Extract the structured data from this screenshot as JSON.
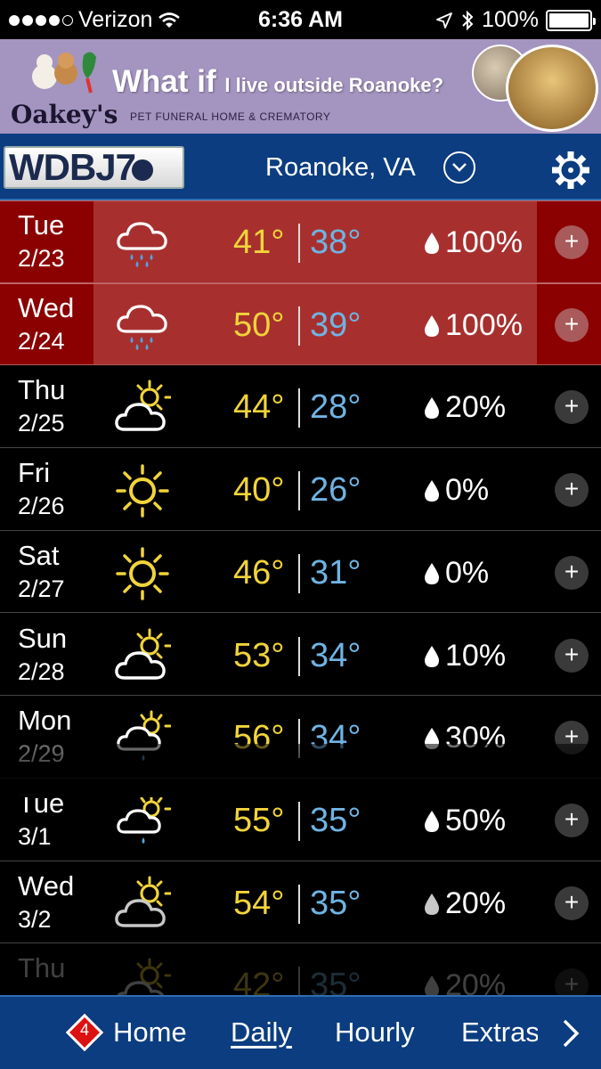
{
  "status_bar": {
    "carrier": "Verizon",
    "time": "6:36 AM",
    "battery": "100%",
    "signal_bars_filled": 4,
    "signal_bars_total": 5
  },
  "ad": {
    "headline_main": "What if",
    "headline_small": "I live outside Roanoke?",
    "brand": "Oakey's",
    "sub": "PET FUNERAL HOME & CREMATORY"
  },
  "header": {
    "logo_text": "WDBJ",
    "logo_number": "7",
    "city": "Roanoke, VA"
  },
  "colors": {
    "alert_bg": "#8b0000",
    "alert_band": "#a7302f",
    "header_bg": "#0b3d80",
    "high_temp": "#f1d43a",
    "low_temp": "#6fb4e3"
  },
  "forecast": [
    {
      "day": "Tue",
      "date": "2/23",
      "icon": "rain-icon",
      "high": "41°",
      "low": "38°",
      "precip": "100%",
      "alert": true
    },
    {
      "day": "Wed",
      "date": "2/24",
      "icon": "rain-icon",
      "high": "50°",
      "low": "39°",
      "precip": "100%",
      "alert": true
    },
    {
      "day": "Thu",
      "date": "2/25",
      "icon": "partly-cloudy-icon",
      "high": "44°",
      "low": "28°",
      "precip": "20%",
      "alert": false
    },
    {
      "day": "Fri",
      "date": "2/26",
      "icon": "sunny-icon",
      "high": "40°",
      "low": "26°",
      "precip": "0%",
      "alert": false
    },
    {
      "day": "Sat",
      "date": "2/27",
      "icon": "sunny-icon",
      "high": "46°",
      "low": "31°",
      "precip": "0%",
      "alert": false
    },
    {
      "day": "Sun",
      "date": "2/28",
      "icon": "partly-cloudy-icon",
      "high": "53°",
      "low": "34°",
      "precip": "10%",
      "alert": false
    },
    {
      "day": "Mon",
      "date": "2/29",
      "icon": "sun-showers-icon",
      "high": "56°",
      "low": "34°",
      "precip": "30%",
      "alert": false
    },
    {
      "day": "Tue",
      "date": "3/1",
      "icon": "sun-showers-icon",
      "high": "55°",
      "low": "35°",
      "precip": "50%",
      "alert": false
    },
    {
      "day": "Wed",
      "date": "3/2",
      "icon": "partly-cloudy-icon",
      "high": "54°",
      "low": "35°",
      "precip": "20%",
      "alert": false
    },
    {
      "day": "Thu",
      "date": "",
      "icon": "partly-cloudy-icon",
      "high": "42°",
      "low": "35°",
      "precip": "20%",
      "alert": false
    }
  ],
  "nav": {
    "badge": "4",
    "home": "Home",
    "daily": "Daily",
    "hourly": "Hourly",
    "extras": "Extras"
  }
}
